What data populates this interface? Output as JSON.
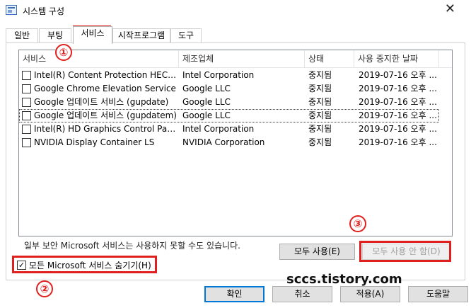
{
  "window": {
    "title": "시스템 구성",
    "close_glyph": "✕"
  },
  "tabs": [
    {
      "label": "일반"
    },
    {
      "label": "부팅"
    },
    {
      "label": "서비스"
    },
    {
      "label": "시작프로그램"
    },
    {
      "label": "도구"
    }
  ],
  "services": {
    "columns": [
      "서비스",
      "제조업체",
      "상태",
      "사용 중지한 날짜"
    ],
    "rows": [
      {
        "name": "Intel(R) Content Protection HECI Se...",
        "maker": "Intel Corporation",
        "status": "중지됨",
        "date": "2019-07-16 오후 ...",
        "checked": false
      },
      {
        "name": "Google Chrome Elevation Service",
        "maker": "Google LLC",
        "status": "중지됨",
        "date": "2019-07-16 오후 ...",
        "checked": false
      },
      {
        "name": "Google 업데이트 서비스 (gupdate)",
        "maker": "Google LLC",
        "status": "중지됨",
        "date": "2019-07-16 오후 ...",
        "checked": false
      },
      {
        "name": "Google 업데이트 서비스 (gupdatem)",
        "maker": "Google LLC",
        "status": "중지됨",
        "date": "2019-07-16 오후 ...",
        "checked": false
      },
      {
        "name": "Intel(R) HD Graphics Control Panel ...",
        "maker": "Intel Corporation",
        "status": "중지됨",
        "date": "2019-07-16 오후 ...",
        "checked": false
      },
      {
        "name": "NVIDIA Display Container LS",
        "maker": "NVIDIA Corporation",
        "status": "중지됨",
        "date": "2019-07-16 오후 ...",
        "checked": false
      }
    ]
  },
  "note": "일부 보안 Microsoft 서비스는 사용하지 못할 수도 있습니다.",
  "hide_microsoft": {
    "checkmark": "✓",
    "label": "모든 Microsoft 서비스 숨기기(H)",
    "checked": true
  },
  "buttons": {
    "enable_all": "모두 사용(E)",
    "disable_all": "모두 사용 안 함(D)",
    "ok": "확인",
    "cancel": "취소",
    "apply": "적용(A)",
    "help": "도움말"
  },
  "annotations": {
    "one": "①",
    "two": "②",
    "three": "③",
    "color": "#e0201f"
  },
  "watermark": "sccs.tistory.com"
}
